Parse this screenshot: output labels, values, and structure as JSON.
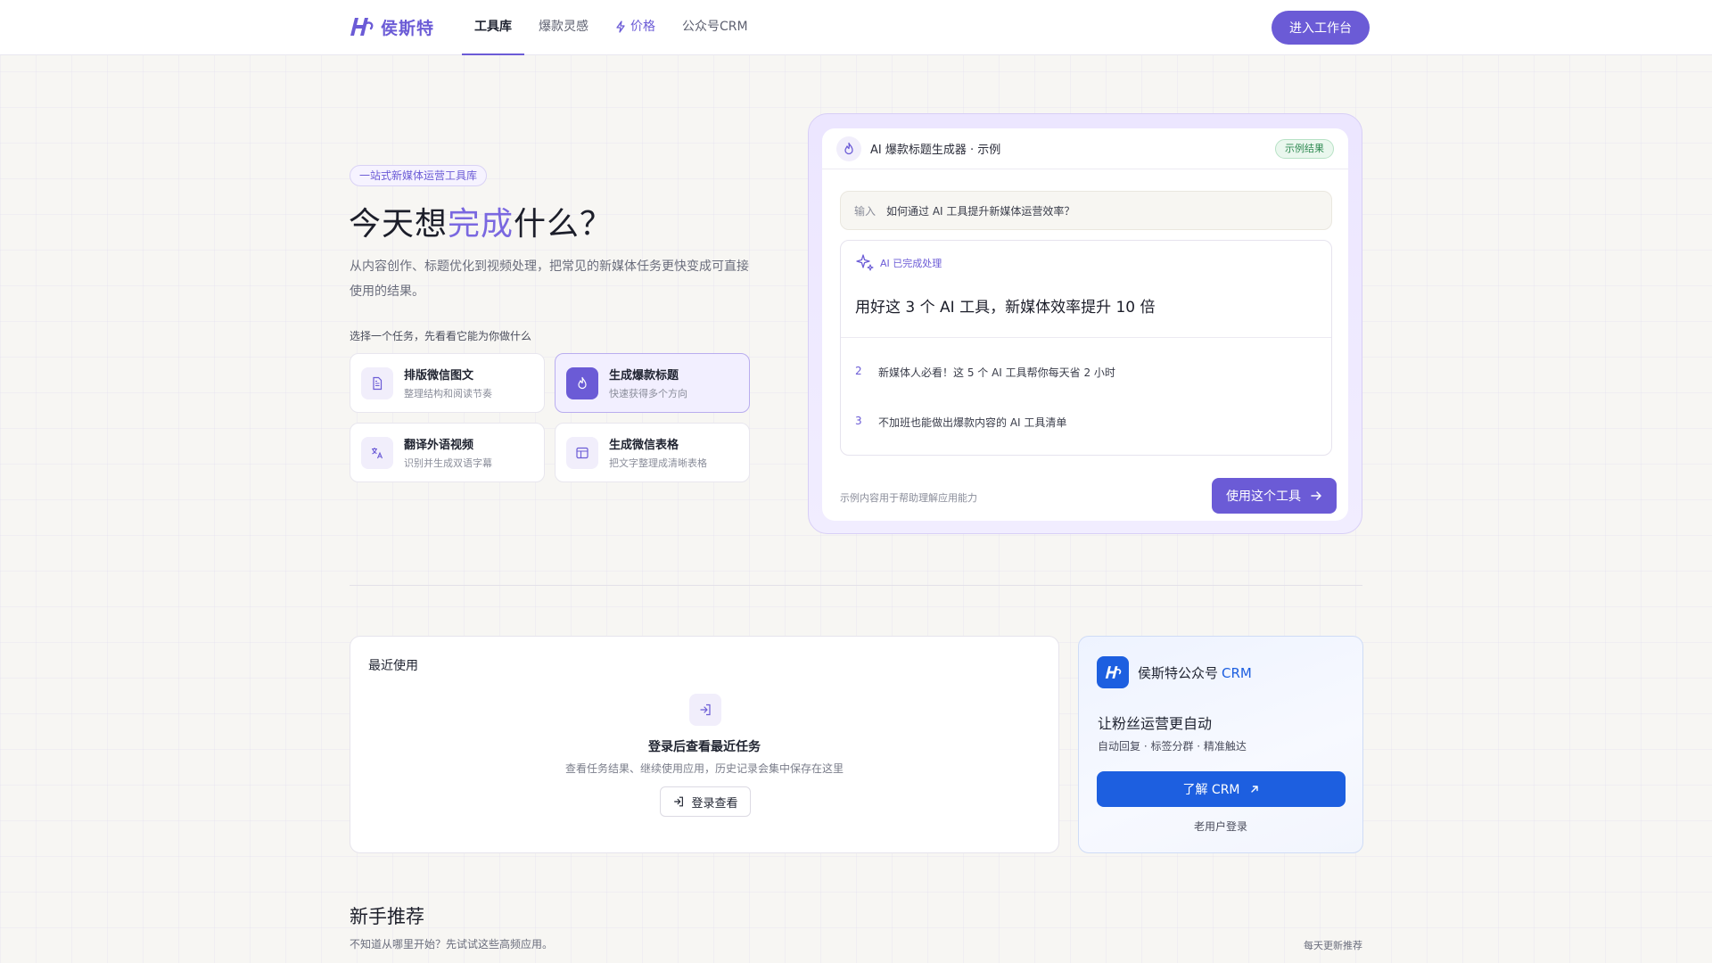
{
  "nav": {
    "brand": "侯斯特",
    "tabs": [
      {
        "label": "工具库"
      },
      {
        "label": "爆款灵感"
      },
      {
        "label": "价格"
      },
      {
        "label": "公众号CRM"
      }
    ],
    "cta": "进入工作台"
  },
  "hero": {
    "pill": "一站式新媒体运营工具库",
    "title_prefix": "今天想",
    "title_accent": "完成",
    "title_suffix": "什么？",
    "description": "从内容创作、标题优化到视频处理，把常见的新媒体任务更快变成可直接使用的结果。",
    "task_hint": "选择一个任务，先看看它能为你做什么",
    "tasks": [
      {
        "name": "排版微信图文",
        "sub": "整理结构和阅读节奏",
        "icon": "document-icon"
      },
      {
        "name": "生成爆款标题",
        "sub": "快速获得多个方向",
        "icon": "flame-icon"
      },
      {
        "name": "翻译外语视频",
        "sub": "识别并生成双语字幕",
        "icon": "translate-icon"
      },
      {
        "name": "生成微信表格",
        "sub": "把文字整理成清晰表格",
        "icon": "table-icon"
      }
    ],
    "selected_task_index": 1
  },
  "demo": {
    "title": "AI 爆款标题生成器 · 示例",
    "badge": "示例结果",
    "input_label": "输入",
    "input_text": "如何通过 AI 工具提升新媒体运营效率？",
    "status": "AI 已完成处理",
    "headline": "用好这 3 个 AI 工具，新媒体效率提升 10 倍",
    "alternatives": [
      {
        "num": "2",
        "text": "新媒体人必看！这 5 个 AI 工具帮你每天省 2 小时"
      },
      {
        "num": "3",
        "text": "不加班也能做出爆款内容的 AI 工具清单"
      }
    ],
    "note": "示例内容用于帮助理解应用能力",
    "cta": "使用这个工具"
  },
  "recent": {
    "title": "最近使用",
    "empty_title": "登录后查看最近任务",
    "empty_desc": "查看任务结果、继续使用应用，历史记录会集中保存在这里",
    "login_button": "登录查看"
  },
  "crm": {
    "name": "侯斯特公众号",
    "name_accent": "CRM",
    "headline": "让粉丝运营更自动",
    "features": "自动回复 · 标签分群 · 精准触达",
    "button": "了解 CRM",
    "login": "老用户登录"
  },
  "recommend": {
    "title": "新手推荐",
    "subtitle": "不知道从哪里开始？先试试这些高频应用。",
    "right": "每天更新推荐"
  },
  "colors": {
    "brand_purple": "#6b5bd6",
    "crm_blue": "#1d5fe0",
    "success_green": "#2f8a52"
  }
}
